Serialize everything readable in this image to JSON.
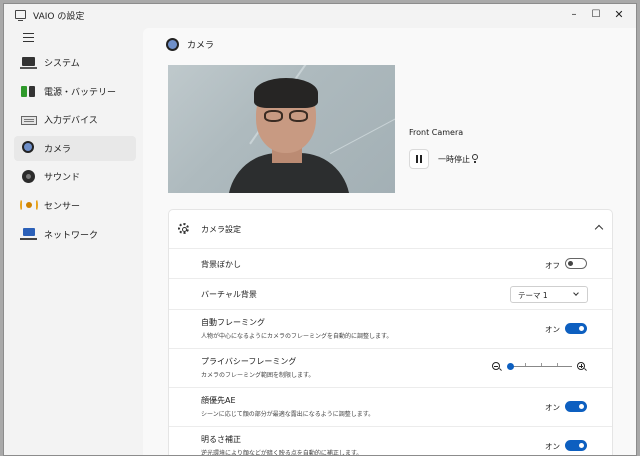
{
  "window": {
    "title": "VAIO の設定"
  },
  "window_controls": {
    "minimize": "–",
    "maximize": "☐",
    "close": "✕"
  },
  "sidebar": {
    "items": [
      {
        "label": "システム",
        "icon": "laptop-icon"
      },
      {
        "label": "電源・バッテリー",
        "icon": "battery-icon"
      },
      {
        "label": "入力デバイス",
        "icon": "keyboard-icon"
      },
      {
        "label": "カメラ",
        "icon": "camera-icon",
        "selected": true
      },
      {
        "label": "サウンド",
        "icon": "speaker-icon"
      },
      {
        "label": "センサー",
        "icon": "sensor-icon"
      },
      {
        "label": "ネットワーク",
        "icon": "network-icon"
      }
    ]
  },
  "page": {
    "title": "カメラ",
    "icon": "camera-icon"
  },
  "camera": {
    "name": "Front Camera",
    "pause_label": "一時停止",
    "pause_icon": "pause-icon",
    "hint_icon": "lightbulb-icon"
  },
  "camera_settings": {
    "title": "カメラ設定",
    "icon": "gear-icon",
    "rows": [
      {
        "title": "背景ぼかし",
        "desc": "",
        "state": "オフ",
        "on": false
      },
      {
        "title": "バーチャル背景",
        "desc": "",
        "select_value": "テーマ 1"
      },
      {
        "title": "自動フレーミング",
        "desc": "人物が中心になるようにカメラのフレーミングを自動的に調整します。",
        "state": "オン",
        "on": true
      },
      {
        "title": "プライバシーフレーミング",
        "desc": "カメラのフレーミング範囲を制限します。",
        "slider_level": 0
      },
      {
        "title": "顔優先AE",
        "desc": "シーンに応じて顔の部分が最適な露出になるように調整します。",
        "state": "オン",
        "on": true
      },
      {
        "title": "明るさ補正",
        "desc": "逆光環境により顔などが暗く映る点を自動的に補正します。",
        "state": "オン",
        "on": true
      }
    ]
  },
  "colors": {
    "accent": "#0d5fc0",
    "window_bg": "#f3f3f3",
    "card_bg": "#ffffff"
  }
}
